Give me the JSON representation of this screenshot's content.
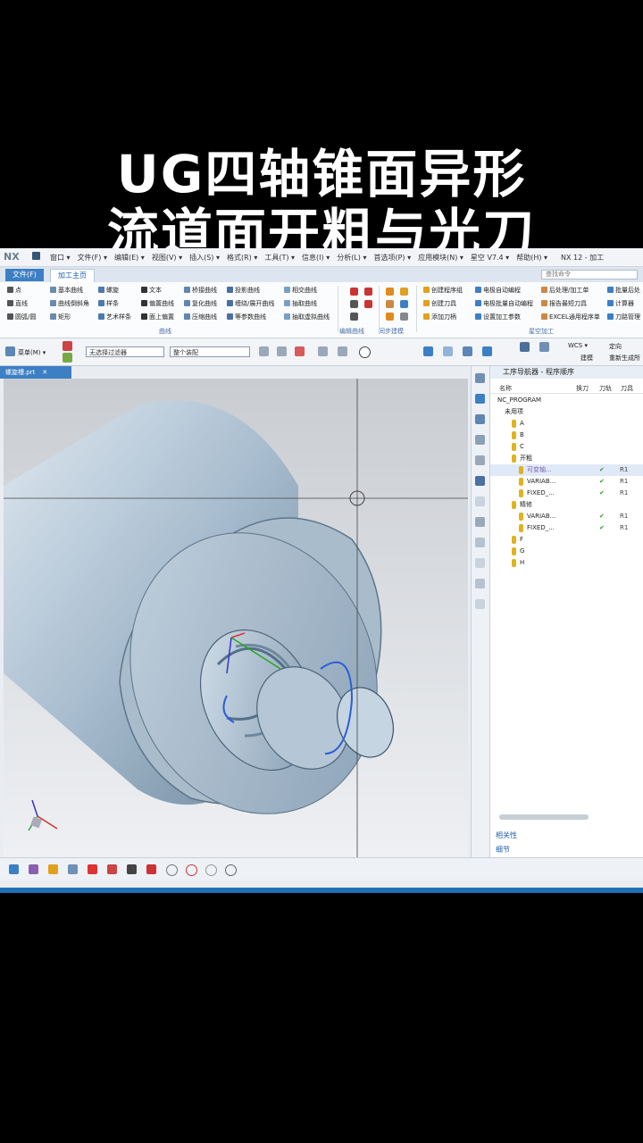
{
  "overlay": {
    "line1": "UG四轴锥面异形",
    "line2": "流道面开粗与光刀"
  },
  "titlebar": {
    "logo": "NX",
    "menu": [
      "窗口 ▾",
      "文件(F) ▾",
      "编辑(E) ▾",
      "视图(V) ▾",
      "插入(S) ▾",
      "格式(R) ▾",
      "工具(T) ▾",
      "信息(I) ▾",
      "分析(L) ▾",
      "首选项(P) ▾",
      "应用模块(N) ▾",
      "星空 V7.4 ▾",
      "帮助(H) ▾"
    ],
    "window_title": "NX 12 - 加工"
  },
  "tabs": {
    "file": "文件(F)",
    "home": "加工主页"
  },
  "command_finder": {
    "placeholder": "查找命令"
  },
  "ribbon": {
    "curve_col1": [
      "点",
      "直线",
      "圆弧/圆"
    ],
    "curve_col2": [
      "基本曲线",
      "曲线倒斜角",
      "矩形"
    ],
    "curve_col3": [
      "螺旋",
      "样条",
      "艺术样条"
    ],
    "curve_col4": [
      "文本",
      "偏置曲线",
      "面上偏置"
    ],
    "curve_col5": [
      "桥接曲线",
      "复化曲线",
      "压缩曲线"
    ],
    "curve_col6": [
      "投影曲线",
      "缠绕/展开曲线",
      "等参数曲线"
    ],
    "curve_col7": [
      "相交曲线",
      "抽取曲线",
      "抽取虚拟曲线"
    ],
    "cam_col1": [
      "创建程序组",
      "创建刀具",
      "添加刀柄"
    ],
    "cam_col2": [
      "电极自动编程",
      "电极批量自动编程",
      "设置加工参数"
    ],
    "cam_col3": [
      "后处理/加工单",
      "报告最短刀具",
      "EXCEL通用程序单"
    ],
    "cam_col4": [
      "批量后处",
      "计算器",
      "刀路管理"
    ],
    "groups": [
      "曲线",
      "编辑曲线",
      "同步建模",
      "星空加工"
    ]
  },
  "filterbar": {
    "menu_label": "菜单(M) ▾",
    "filter_value": "无选择过滤器",
    "scope_value": "整个装配",
    "wcs": "WCS ▾",
    "btn1": "定向",
    "btn2": "建模",
    "btn3": "重新生成所"
  },
  "viewport_tab": "螺旋槽.prt",
  "navigator": {
    "title": "工序导航器 - 程序顺序",
    "columns": [
      "名称",
      "换刀",
      "刀轨",
      "刀具"
    ],
    "rows": [
      {
        "name": "NC_PROGRAM",
        "indent": 0,
        "check": "",
        "tool": "",
        "pin": false,
        "hl": false
      },
      {
        "name": "未用项",
        "indent": 1,
        "check": "",
        "tool": "",
        "pin": false,
        "hl": false
      },
      {
        "name": "A",
        "indent": 2,
        "check": "",
        "tool": "",
        "pin": true,
        "hl": false
      },
      {
        "name": "B",
        "indent": 2,
        "check": "",
        "tool": "",
        "pin": true,
        "hl": false
      },
      {
        "name": "C",
        "indent": 2,
        "check": "",
        "tool": "",
        "pin": true,
        "hl": false
      },
      {
        "name": "开粗",
        "indent": 2,
        "check": "",
        "tool": "",
        "pin": true,
        "hl": false
      },
      {
        "name": "可变轴...",
        "indent": 3,
        "check": "✔",
        "tool": "R1",
        "pin": true,
        "hl": true
      },
      {
        "name": "VARIAB...",
        "indent": 3,
        "check": "✔",
        "tool": "R1",
        "pin": true,
        "hl": false
      },
      {
        "name": "FIXED_...",
        "indent": 3,
        "check": "✔",
        "tool": "R1",
        "pin": true,
        "hl": false
      },
      {
        "name": "精修",
        "indent": 2,
        "check": "",
        "tool": "",
        "pin": true,
        "hl": false
      },
      {
        "name": "VARIAB...",
        "indent": 3,
        "check": "✔",
        "tool": "R1",
        "pin": true,
        "hl": false
      },
      {
        "name": "FIXED_...",
        "indent": 3,
        "check": "✔",
        "tool": "R1",
        "pin": true,
        "hl": false
      },
      {
        "name": "F",
        "indent": 2,
        "check": "",
        "tool": "",
        "pin": true,
        "hl": false
      },
      {
        "name": "G",
        "indent": 2,
        "check": "",
        "tool": "",
        "pin": true,
        "hl": false
      },
      {
        "name": "H",
        "indent": 2,
        "check": "",
        "tool": "",
        "pin": true,
        "hl": false
      }
    ],
    "footer": [
      "相关性",
      "细节"
    ]
  }
}
